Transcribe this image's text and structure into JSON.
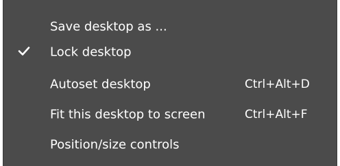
{
  "menu": {
    "items": [
      {
        "label": "Save desktop as ...",
        "shortcut": "",
        "checked": false
      },
      {
        "label": "Lock desktop",
        "shortcut": "",
        "checked": true
      },
      {
        "label": "Autoset desktop",
        "shortcut": "Ctrl+Alt+D",
        "checked": false
      },
      {
        "label": "Fit this desktop to screen",
        "shortcut": "Ctrl+Alt+F",
        "checked": false
      },
      {
        "label": "Position/size controls",
        "shortcut": "",
        "checked": false
      }
    ],
    "check_icon": "checkmark-icon",
    "colors": {
      "background": "#4b4b4b",
      "text": "#ffffff"
    }
  }
}
